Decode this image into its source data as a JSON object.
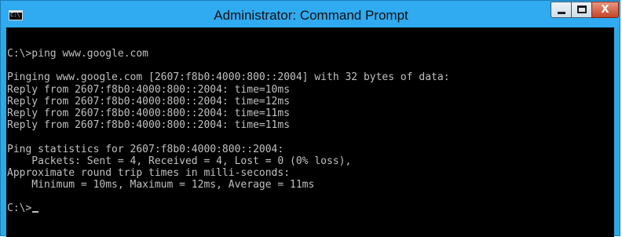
{
  "window": {
    "title": "Administrator: Command Prompt",
    "icon": "console-icon",
    "icon_glyph": "C:\\",
    "controls": {
      "minimize": "minimize-icon",
      "maximize": "maximize-icon",
      "close": "close-icon",
      "close_glyph": "X",
      "close_color": "#c4442a"
    },
    "frame_color": "#30aaf0"
  },
  "console": {
    "background": "#000000",
    "foreground": "#c0c0c0",
    "lines": [
      "C:\\>ping www.google.com",
      "",
      "Pinging www.google.com [2607:f8b0:4000:800::2004] with 32 bytes of data:",
      "Reply from 2607:f8b0:4000:800::2004: time=10ms",
      "Reply from 2607:f8b0:4000:800::2004: time=12ms",
      "Reply from 2607:f8b0:4000:800::2004: time=11ms",
      "Reply from 2607:f8b0:4000:800::2004: time=11ms",
      "",
      "Ping statistics for 2607:f8b0:4000:800::2004:",
      "    Packets: Sent = 4, Received = 4, Lost = 0 (0% loss),",
      "Approximate round trip times in milli-seconds:",
      "    Minimum = 10ms, Maximum = 12ms, Average = 11ms",
      "",
      "C:\\>"
    ]
  }
}
